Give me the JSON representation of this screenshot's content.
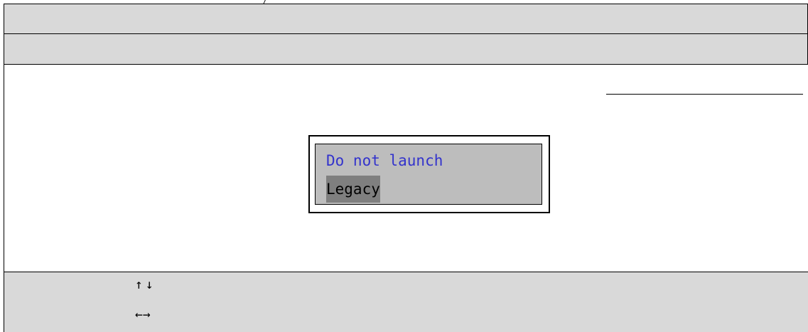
{
  "popup": {
    "options": [
      {
        "label": "Do not launch",
        "selected": false
      },
      {
        "label": "Legacy",
        "selected": true
      }
    ]
  },
  "footer": {
    "updown_hint": "↑↓",
    "leftright_hint": "←→"
  },
  "colors": {
    "bar_background": "#d9d9d9",
    "popup_background": "#bdbdbd",
    "highlight_background": "#7f7f7f",
    "option_text": "#3333cc"
  }
}
